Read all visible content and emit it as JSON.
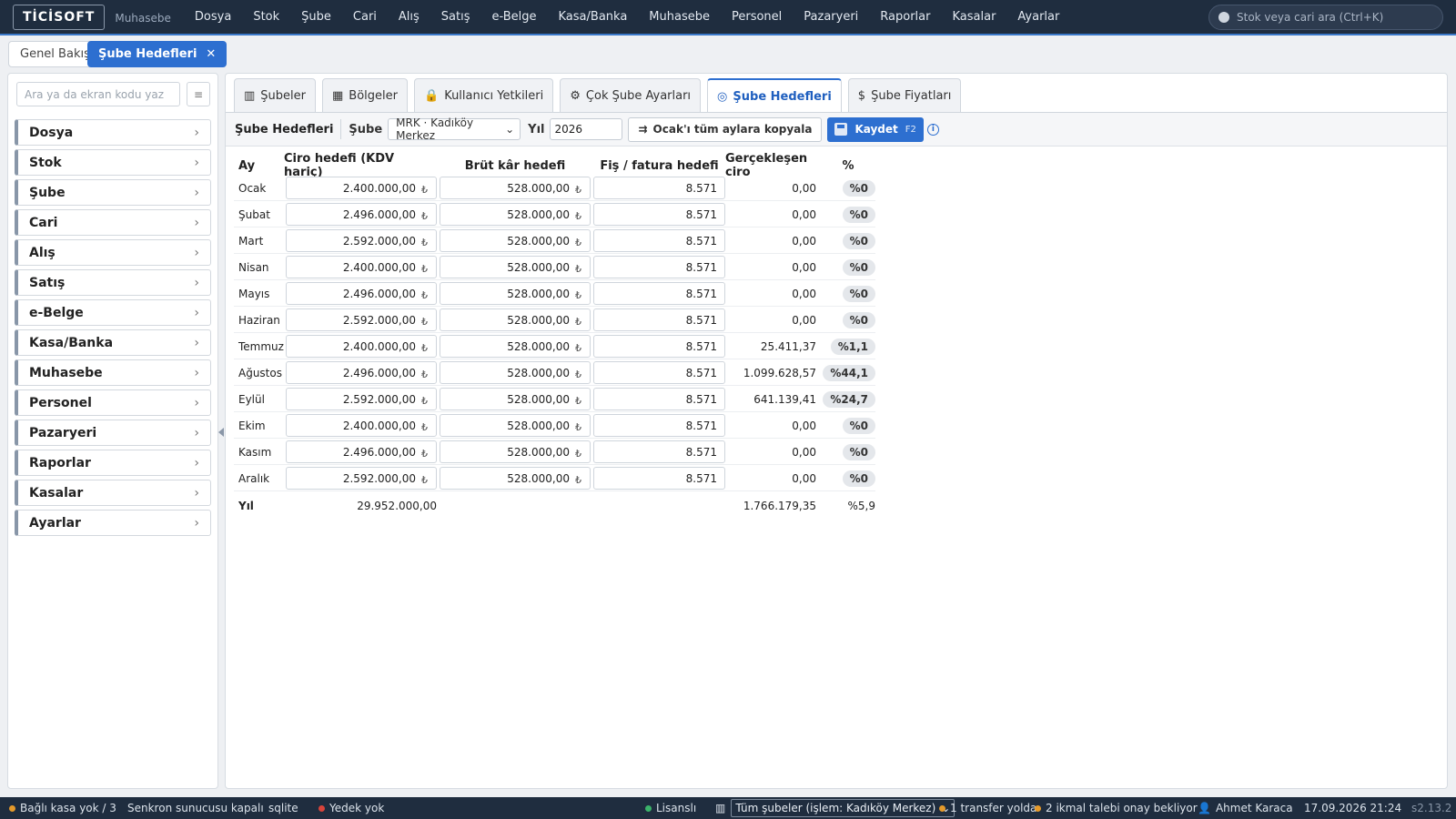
{
  "app": {
    "logo": "TİCİSOFT",
    "subtitle": "Muhasebe"
  },
  "topmenu": [
    "Dosya",
    "Stok",
    "Şube",
    "Cari",
    "Alış",
    "Satış",
    "e-Belge",
    "Kasa/Banka",
    "Muhasebe",
    "Personel",
    "Pazaryeri",
    "Raporlar",
    "Kasalar",
    "Ayarlar"
  ],
  "search": {
    "placeholder": "Stok veya cari ara (Ctrl+K)"
  },
  "doctabs": {
    "overview": "Genel Bakış",
    "active": "Şube Hedefleri",
    "close": "✕"
  },
  "sidebar": {
    "search_placeholder": "Ara ya da ekran kodu yaz",
    "menu_button": "≡",
    "items": [
      "Dosya",
      "Stok",
      "Şube",
      "Cari",
      "Alış",
      "Satış",
      "e-Belge",
      "Kasa/Banka",
      "Muhasebe",
      "Personel",
      "Pazaryeri",
      "Raporlar",
      "Kasalar",
      "Ayarlar"
    ]
  },
  "subtabs": [
    {
      "label": "Şubeler",
      "icon": "building-icon",
      "glyph": "▥"
    },
    {
      "label": "Bölgeler",
      "icon": "map-icon",
      "glyph": "▦"
    },
    {
      "label": "Kullanıcı Yetkileri",
      "icon": "lock-icon",
      "glyph": "🔒"
    },
    {
      "label": "Çok Şube Ayarları",
      "icon": "gear-icon",
      "glyph": "⚙"
    },
    {
      "label": "Şube Hedefleri",
      "icon": "target-icon",
      "glyph": "◎"
    },
    {
      "label": "Şube Fiyatları",
      "icon": "dollar-icon",
      "glyph": "$"
    }
  ],
  "toolbar": {
    "title": "Şube Hedefleri",
    "branch_label": "Şube",
    "branch_value": "MRK · Kadıköy Merkez",
    "year_label": "Yıl",
    "year_value": "2026",
    "copy_icon": "⇉",
    "copy_label": "Ocak'ı tüm aylara kopyala",
    "save_label": "Kaydet",
    "save_key": "F2",
    "info": "i"
  },
  "table": {
    "headers": {
      "month": "Ay",
      "revenue": "Ciro hedefi (KDV hariç)",
      "gross": "Brüt kâr hedefi",
      "receipts": "Fiş / fatura hedefi",
      "actual": "Gerçekleşen ciro",
      "pct": "%"
    },
    "currency": "₺",
    "rows": [
      {
        "month": "Ocak",
        "revenue": "2.400.000,00",
        "gross": "528.000,00",
        "receipts": "8.571",
        "actual": "0,00",
        "pct": "%0"
      },
      {
        "month": "Şubat",
        "revenue": "2.496.000,00",
        "gross": "528.000,00",
        "receipts": "8.571",
        "actual": "0,00",
        "pct": "%0"
      },
      {
        "month": "Mart",
        "revenue": "2.592.000,00",
        "gross": "528.000,00",
        "receipts": "8.571",
        "actual": "0,00",
        "pct": "%0"
      },
      {
        "month": "Nisan",
        "revenue": "2.400.000,00",
        "gross": "528.000,00",
        "receipts": "8.571",
        "actual": "0,00",
        "pct": "%0"
      },
      {
        "month": "Mayıs",
        "revenue": "2.496.000,00",
        "gross": "528.000,00",
        "receipts": "8.571",
        "actual": "0,00",
        "pct": "%0"
      },
      {
        "month": "Haziran",
        "revenue": "2.592.000,00",
        "gross": "528.000,00",
        "receipts": "8.571",
        "actual": "0,00",
        "pct": "%0"
      },
      {
        "month": "Temmuz",
        "revenue": "2.400.000,00",
        "gross": "528.000,00",
        "receipts": "8.571",
        "actual": "25.411,37",
        "pct": "%1,1"
      },
      {
        "month": "Ağustos",
        "revenue": "2.496.000,00",
        "gross": "528.000,00",
        "receipts": "8.571",
        "actual": "1.099.628,57",
        "pct": "%44,1"
      },
      {
        "month": "Eylül",
        "revenue": "2.592.000,00",
        "gross": "528.000,00",
        "receipts": "8.571",
        "actual": "641.139,41",
        "pct": "%24,7"
      },
      {
        "month": "Ekim",
        "revenue": "2.400.000,00",
        "gross": "528.000,00",
        "receipts": "8.571",
        "actual": "0,00",
        "pct": "%0"
      },
      {
        "month": "Kasım",
        "revenue": "2.496.000,00",
        "gross": "528.000,00",
        "receipts": "8.571",
        "actual": "0,00",
        "pct": "%0"
      },
      {
        "month": "Aralık",
        "revenue": "2.592.000,00",
        "gross": "528.000,00",
        "receipts": "8.571",
        "actual": "0,00",
        "pct": "%0"
      }
    ],
    "total": {
      "label": "Yıl",
      "revenue": "29.952.000,00",
      "actual": "1.766.179,35",
      "pct": "%5,9"
    }
  },
  "statusbar": {
    "cash": "Bağlı kasa yok / 3",
    "sync": "Senkron sunucusu kapalı",
    "db": "sqlite",
    "backup": "Yedek yok",
    "license": "Lisanslı",
    "branches": "Tüm şubeler (işlem: Kadıköy Merkez)",
    "transfer": "1 transfer yolda",
    "supply": "2 ikmal talebi onay bekliyor",
    "user": "Ahmet Karaca",
    "datetime": "17.09.2026 21:24",
    "version": "s2.13.2"
  },
  "colors": {
    "topbar": "#1f2d3f",
    "accent": "#2d6fd0",
    "status_orange": "#e59a2b",
    "status_red": "#d9443b",
    "status_green": "#3bb36a"
  }
}
